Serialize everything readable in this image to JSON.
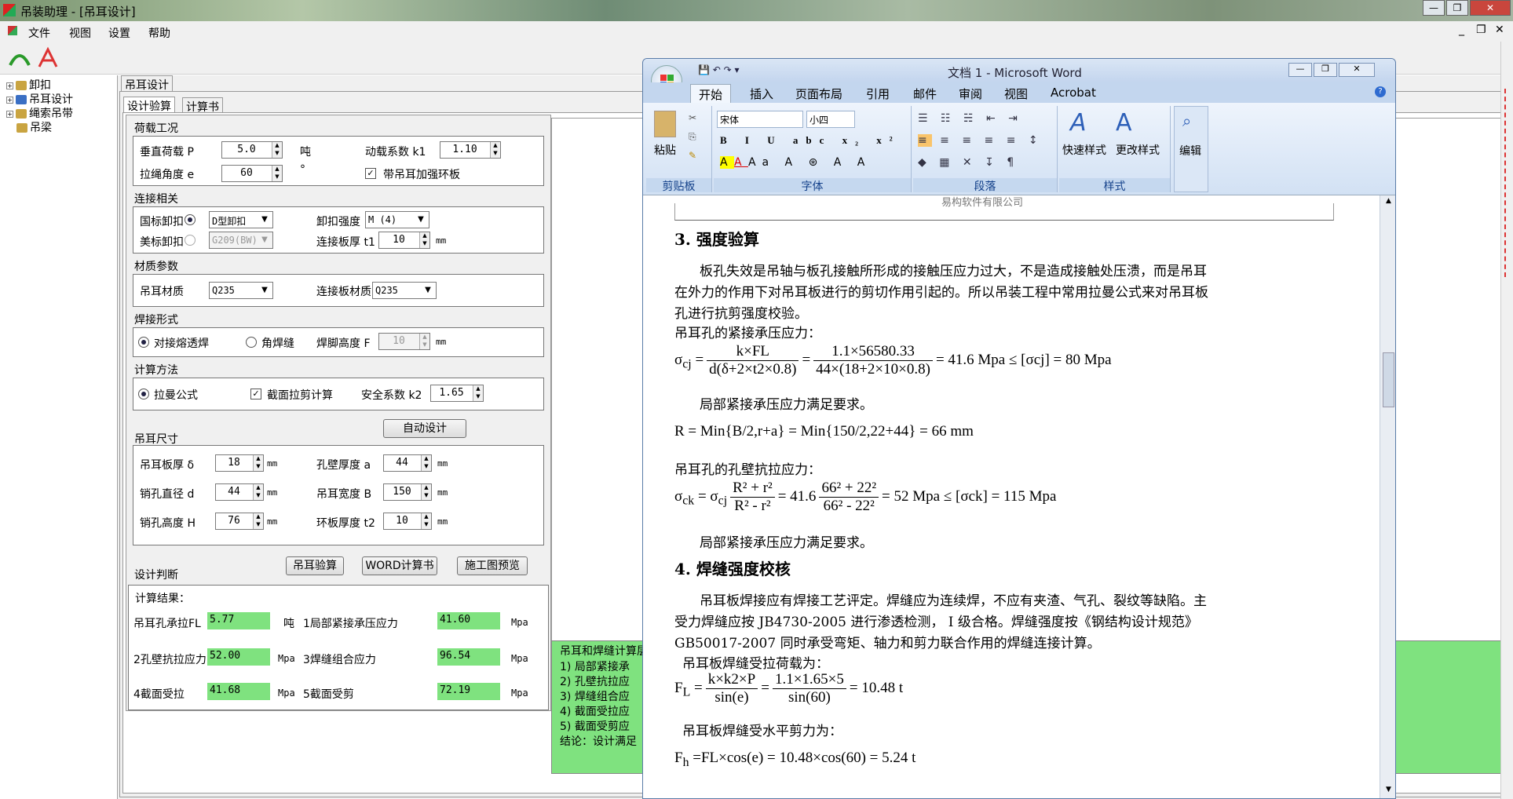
{
  "app": {
    "title": "吊装助理 - [吊耳设计]",
    "menu": [
      "文件",
      "视图",
      "设置",
      "帮助"
    ],
    "tree": [
      "卸扣",
      "吊耳设计",
      "绳索吊带",
      "吊梁"
    ]
  },
  "tabs": {
    "outer": "吊耳设计",
    "inner": [
      "设计验算",
      "计算书"
    ]
  },
  "load": {
    "group": "荷载工况",
    "vertical_label": "垂直荷载 P",
    "vertical_value": "5.0",
    "vertical_unit": "吨",
    "dyn_label": "动载系数 k1",
    "dyn_value": "1.10",
    "angle_label": "拉绳角度 e",
    "angle_value": "60",
    "angle_unit": "°",
    "ring_label": "带吊耳加强环板",
    "ring_checked": true
  },
  "conn": {
    "group": "连接相关",
    "gb_label": "国标卸扣",
    "gb_combo": "D型卸扣",
    "strength_label": "卸扣强度",
    "strength_combo": "M (4)",
    "us_label": "美标卸扣",
    "us_combo": "G209(BW)",
    "plate_label": "连接板厚 t1",
    "plate_value": "10",
    "plate_unit": "mm"
  },
  "material": {
    "group": "材质参数",
    "lug_label": "吊耳材质",
    "lug_value": "Q235",
    "plate_label": "连接板材质",
    "plate_value": "Q235"
  },
  "weld": {
    "group": "焊接形式",
    "butt_label": "对接熔透焊",
    "fillet_label": "角焊缝",
    "foot_label": "焊脚高度 F",
    "foot_value": "10",
    "foot_unit": "mm"
  },
  "method": {
    "group": "计算方法",
    "lame_label": "拉曼公式",
    "shear_label": "截面拉剪计算",
    "safety_label": "安全系数 k2",
    "safety_value": "1.65"
  },
  "size": {
    "group": "吊耳尺寸",
    "auto_button": "自动设计",
    "thick_label": "吊耳板厚 δ",
    "thick_value": "18",
    "wall_label": "孔壁厚度 a",
    "wall_value": "44",
    "pin_label": "销孔直径 d",
    "pin_value": "44",
    "width_label": "吊耳宽度 B",
    "width_value": "150",
    "height_label": "销孔高度 H",
    "height_value": "76",
    "ring_label": "环板厚度 t2",
    "ring_value": "10",
    "unit": "mm"
  },
  "judge": {
    "label": "设计判断",
    "check_button": "吊耳验算",
    "word_button": "WORD计算书",
    "preview_button": "施工图预览"
  },
  "results": {
    "title": "计算结果：",
    "fl_label": "吊耳孔承拉FL",
    "fl_value": "5.77",
    "fl_unit": "吨",
    "r1_label": "1局部紧接承压应力",
    "r1_value": "41.60",
    "r1_unit": "Mpa",
    "r2_label": "2孔壁抗拉应力",
    "r2_value": "52.00",
    "r2_unit": "Mpa",
    "r3_label": "3焊缝组合应力",
    "r3_value": "96.54",
    "r3_unit": "Mpa",
    "r4_label": "4截面受拉",
    "r4_value": "41.68",
    "r4_unit": "Mpa",
    "r5_label": "5截面受剪",
    "r5_value": "72.19",
    "r5_unit": "Mpa"
  },
  "summary": [
    "吊耳和焊缝计算层",
    "1) 局部紧接承",
    "2) 孔壁抗拉应",
    "3) 焊缝组合应",
    "4) 截面受拉应",
    "5) 截面受剪应",
    "结论：设计满足"
  ],
  "word": {
    "title": "文档 1 - Microsoft Word",
    "tabs": [
      "开始",
      "插入",
      "页面布局",
      "引用",
      "邮件",
      "审阅",
      "视图",
      "Acrobat"
    ],
    "groups": [
      "剪贴板",
      "字体",
      "段落",
      "样式"
    ],
    "paste": "粘贴",
    "font": "宋体",
    "size": "小四",
    "quick_style": "快速样式",
    "change_style": "更改样式",
    "edit": "编辑",
    "header_text": "易构软件有限公司",
    "h3": "3. 强度验算",
    "p1a": "板孔失效是吊轴与板孔接触所形成的接触压应力过大，不是造成接触处压溃，而是吊耳",
    "p1b": "在外力的作用下对吊耳板进行的剪切作用引起的。所以吊装工程中常用拉曼公式来对吊耳板",
    "p1c": "孔进行抗剪强度校验。",
    "p2": "吊耳孔的紧接承压应力：",
    "eq1_num1": "k×FL",
    "eq1_den1": "d(δ+2×t2×0.8)",
    "eq1_num2": "1.1×56580.33",
    "eq1_den2": "44×(18+2×10×0.8)",
    "eq1_res": "= 41.6 Mpa ≤ [σcj] = 80 Mpa",
    "ok1": "局部紧接承压应力满足要求。",
    "eq2": "R = Min{B/2,r+a} = Min{150/2,22+44} = 66 mm",
    "p3": "吊耳孔的孔壁抗拉应力：",
    "eq3_res": "= 52 Mpa ≤ [σck] = 115 Mpa",
    "ok2": "局部紧接承压应力满足要求。",
    "h4": "4. 焊缝强度校核",
    "p4a": "吊耳板焊接应有焊接工艺评定。焊缝应为连续焊，不应有夹渣、气孔、裂纹等缺陷。主",
    "p4b": "受力焊缝应按 JB4730-2005 进行渗透检测， I 级合格。焊缝强度按《钢结构设计规范》",
    "p4c": "GB50017-2007  同时承受弯矩、轴力和剪力联合作用的焊缝连接计算。",
    "p5": "吊耳板焊缝受拉荷载为：",
    "eq4_num1": "k×k2×P",
    "eq4_den1": "sin(e)",
    "eq4_num2": "1.1×1.65×5",
    "eq4_den2": "sin(60)",
    "eq4_res": "= 10.48 t",
    "p6": "吊耳板焊缝受水平剪力为：",
    "eq5": "=FL×cos(e) = 10.48×cos(60) = 5.24 t"
  }
}
